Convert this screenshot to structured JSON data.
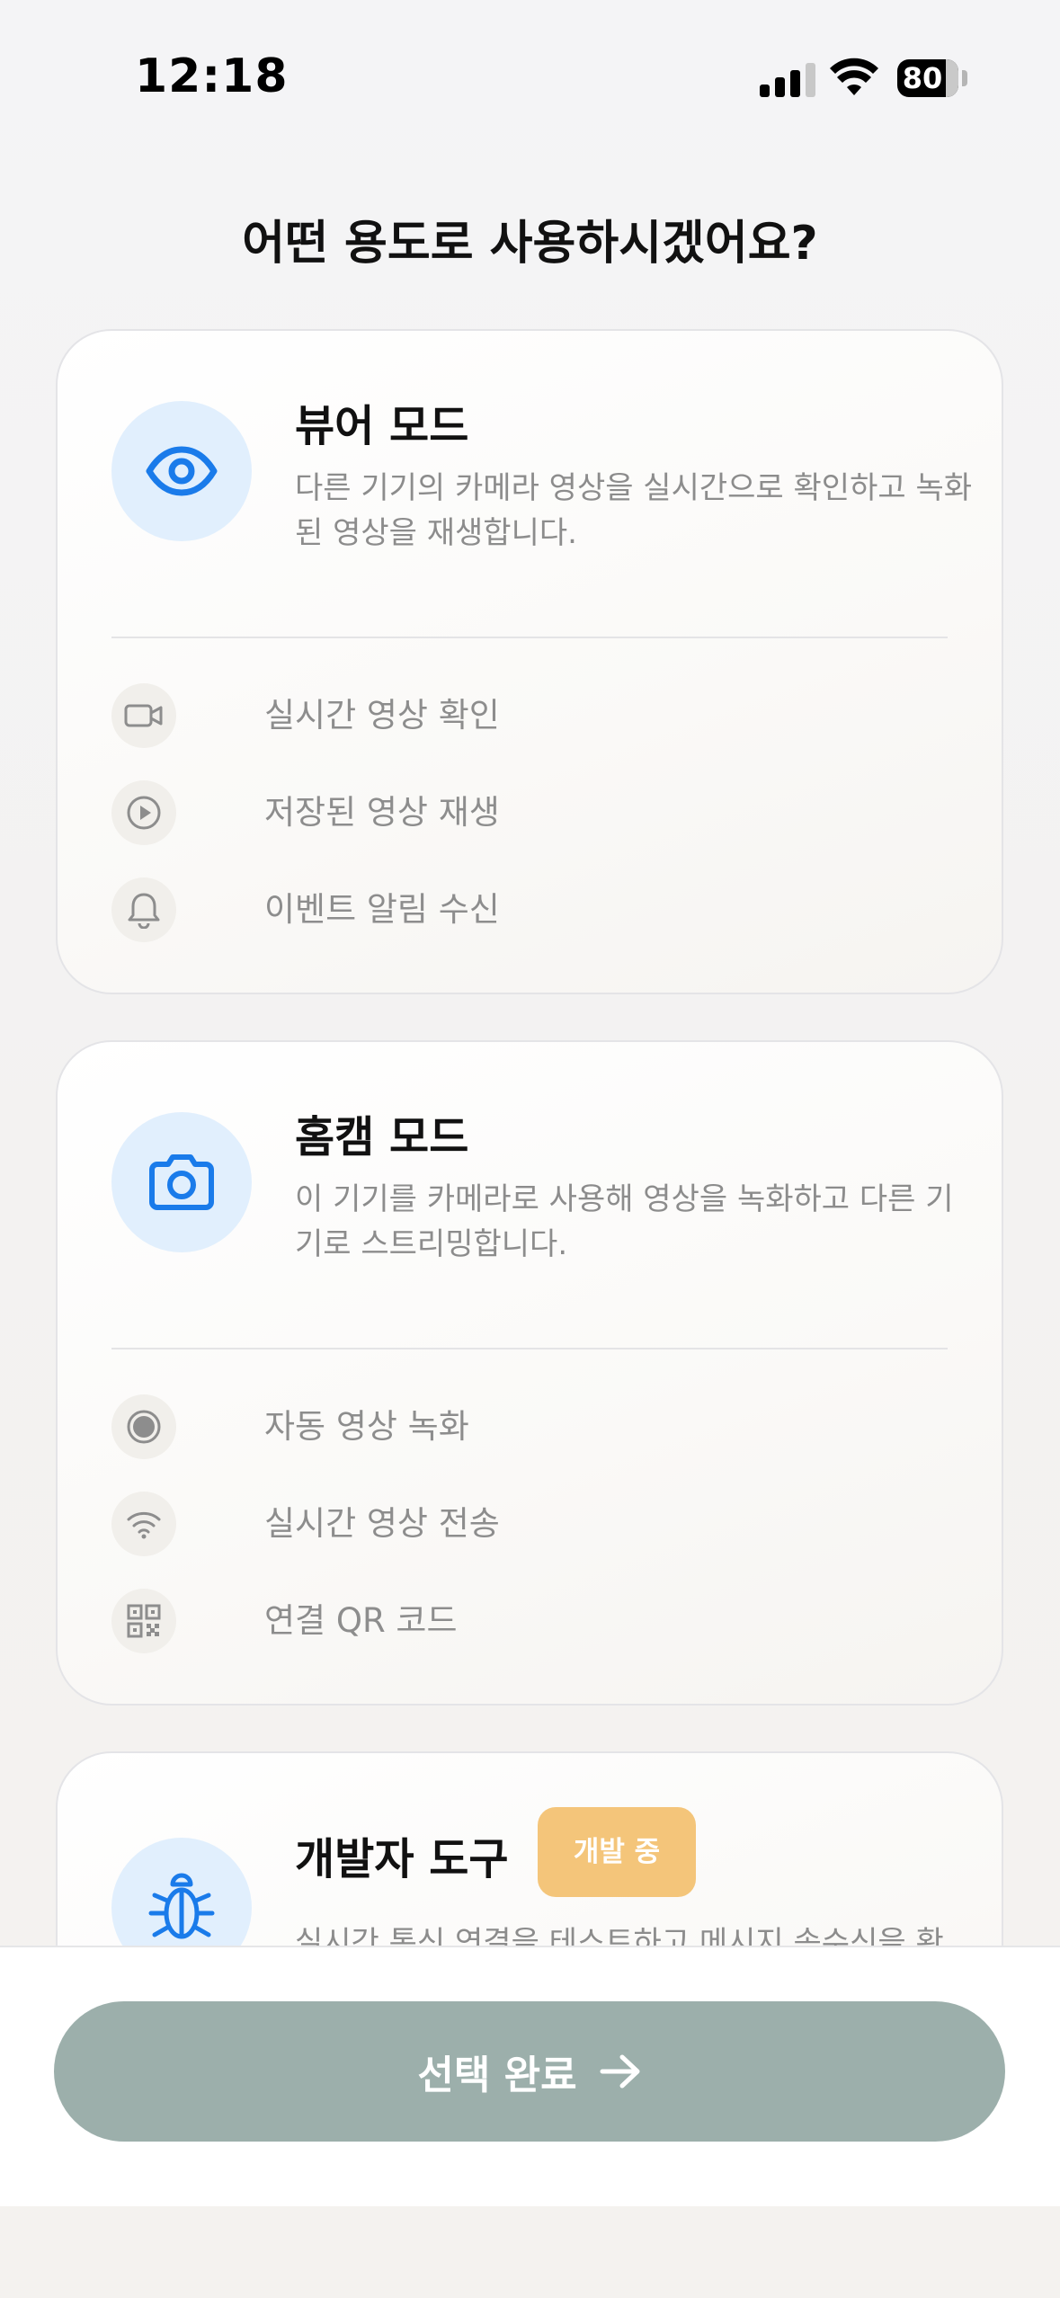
{
  "status_bar": {
    "time": "12:18",
    "battery": "80"
  },
  "page_title": "어떤 용도로 사용하시겠어요?",
  "cards": [
    {
      "title": "뷰어 모드",
      "icon": "eye-icon",
      "description": "다른 기기의 카메라 영상을 실시간으로 확인하고 녹화된 영상을 재생합니다.",
      "features": [
        {
          "icon": "video-camera-icon",
          "label": "실시간 영상 확인"
        },
        {
          "icon": "play-circle-icon",
          "label": "저장된 영상 재생"
        },
        {
          "icon": "bell-icon",
          "label": "이벤트 알림 수신"
        }
      ]
    },
    {
      "title": "홈캠 모드",
      "icon": "camera-icon",
      "description": "이 기기를 카메라로 사용해 영상을 녹화하고 다른 기기로 스트리밍합니다.",
      "features": [
        {
          "icon": "record-icon",
          "label": "자동 영상 녹화"
        },
        {
          "icon": "wifi-icon",
          "label": "실시간 영상 전송"
        },
        {
          "icon": "qr-code-icon",
          "label": "연결 QR 코드"
        }
      ]
    },
    {
      "title": "개발자 도구",
      "icon": "bug-icon",
      "badge": "개발 중",
      "description": "실시간 통신 연결을 테스트하고 메시지 송수신을 확"
    }
  ],
  "done_button": {
    "label": "선택 완료",
    "icon": "arrow-right-icon"
  },
  "colors": {
    "accent": "#1a7bea",
    "badge": "#f4c57a",
    "button": "#9cafab"
  }
}
